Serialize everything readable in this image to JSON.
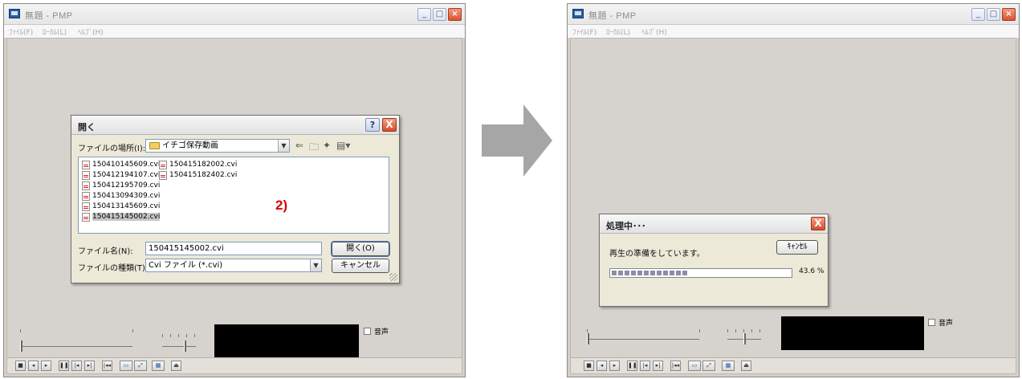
{
  "app": {
    "title": "無題 - PMP",
    "menu": [
      "ﾌｧｲﾙ(F)",
      "ﾛｰｶﾙ(L)",
      "ﾍﾙﾌﾟ(H)"
    ],
    "sound_label": "音声"
  },
  "open_dialog": {
    "title": "開く",
    "look_in_label": "ファイルの場所(I):",
    "look_in_value": "イチゴ保存動画",
    "files": [
      {
        "name": "150410145609.cvi",
        "selected": false
      },
      {
        "name": "150412194107.cvi",
        "selected": false
      },
      {
        "name": "150412195709.cvi",
        "selected": false
      },
      {
        "name": "150413094309.cvi",
        "selected": false
      },
      {
        "name": "150413145609.cvi",
        "selected": false
      },
      {
        "name": "150415145002.cvi",
        "selected": true
      },
      {
        "name": "150415182002.cvi",
        "selected": false
      },
      {
        "name": "150415182402.cvi",
        "selected": false
      }
    ],
    "filename_label": "ファイル名(N):",
    "filename_value": "150415145002.cvi",
    "filetype_label": "ファイルの種類(T):",
    "filetype_value": "Cvi ファイル (*.cvi)",
    "open_button": "開く(O)",
    "cancel_button": "キャンセル",
    "help_symbol": "?",
    "close_symbol": "X"
  },
  "annotation": "2)",
  "processing_dialog": {
    "title": "処理中･･･",
    "message": "再生の準備をしています。",
    "cancel_button": "ｷｬﾝｾﾙ",
    "progress_percent": 43.6,
    "progress_text": "43.6 %",
    "close_symbol": "X"
  },
  "colors": {
    "arrow": "#a6a6a6",
    "annotation": "#e00000",
    "window_bg": "#d4d0c8",
    "video_bg": "#000000"
  }
}
